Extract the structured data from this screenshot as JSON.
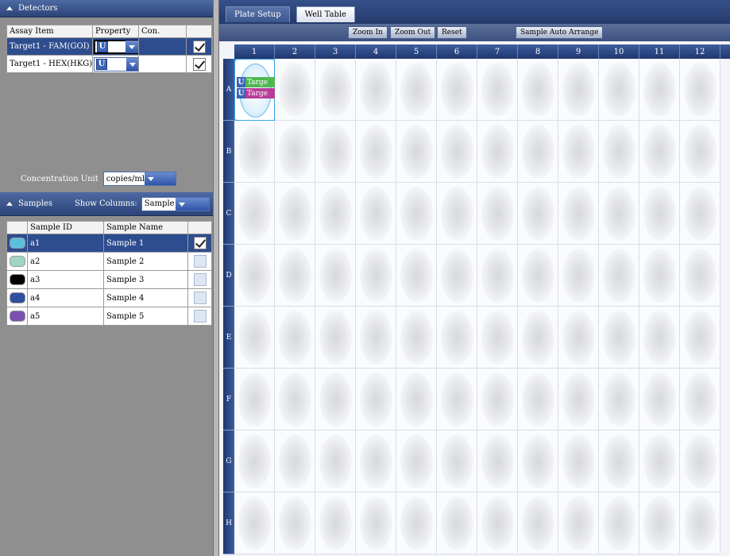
{
  "detectors": {
    "title": "Detectors",
    "columns": [
      "Assay Item",
      "Property",
      "Con."
    ],
    "rows": [
      {
        "assay": "Target1 - FAM(GOI)",
        "property": "U",
        "con": "",
        "checked": true,
        "selected": true
      },
      {
        "assay": "Target1 - HEX(HKG)",
        "property": "U",
        "con": "",
        "checked": true,
        "selected": false
      }
    ],
    "concentration_label": "Concentration Unit",
    "concentration_value": "copies/ml"
  },
  "samples": {
    "title": "Samples",
    "show_columns_label": "Show Columns:",
    "show_columns_value": "Sample Name",
    "columns": [
      "Sample ID",
      "Sample Name"
    ],
    "rows": [
      {
        "color": "#5bc0de",
        "id": "a1",
        "name": "Sample 1",
        "checked": true,
        "selected": true
      },
      {
        "color": "#9fd6c3",
        "id": "a2",
        "name": "Sample 2",
        "checked": false,
        "selected": false
      },
      {
        "color": "#000000",
        "id": "a3",
        "name": "Sample 3",
        "checked": false,
        "selected": false
      },
      {
        "color": "#2f4fa0",
        "id": "a4",
        "name": "Sample 4",
        "checked": false,
        "selected": false
      },
      {
        "color": "#7b4fb0",
        "id": "a5",
        "name": "Sample 5",
        "checked": false,
        "selected": false
      }
    ]
  },
  "tabs": [
    {
      "label": "Plate Setup",
      "active": false
    },
    {
      "label": "Well Table",
      "active": true
    }
  ],
  "toolbar": {
    "zoom_in": "Zoom In",
    "zoom_out": "Zoom Out",
    "reset": "Reset",
    "auto_arrange": "Sample Auto Arrange"
  },
  "plate": {
    "columns": [
      "1",
      "2",
      "3",
      "4",
      "5",
      "6",
      "7",
      "8",
      "9",
      "10",
      "11",
      "12"
    ],
    "rows": [
      "A",
      "B",
      "C",
      "D",
      "E",
      "F",
      "G",
      "H"
    ],
    "active_well": {
      "row": "A",
      "col": "1",
      "tags": [
        {
          "badge": "U",
          "text": "Targe",
          "dye": "fam"
        },
        {
          "badge": "U",
          "text": "Targe",
          "dye": "hex"
        }
      ]
    }
  }
}
